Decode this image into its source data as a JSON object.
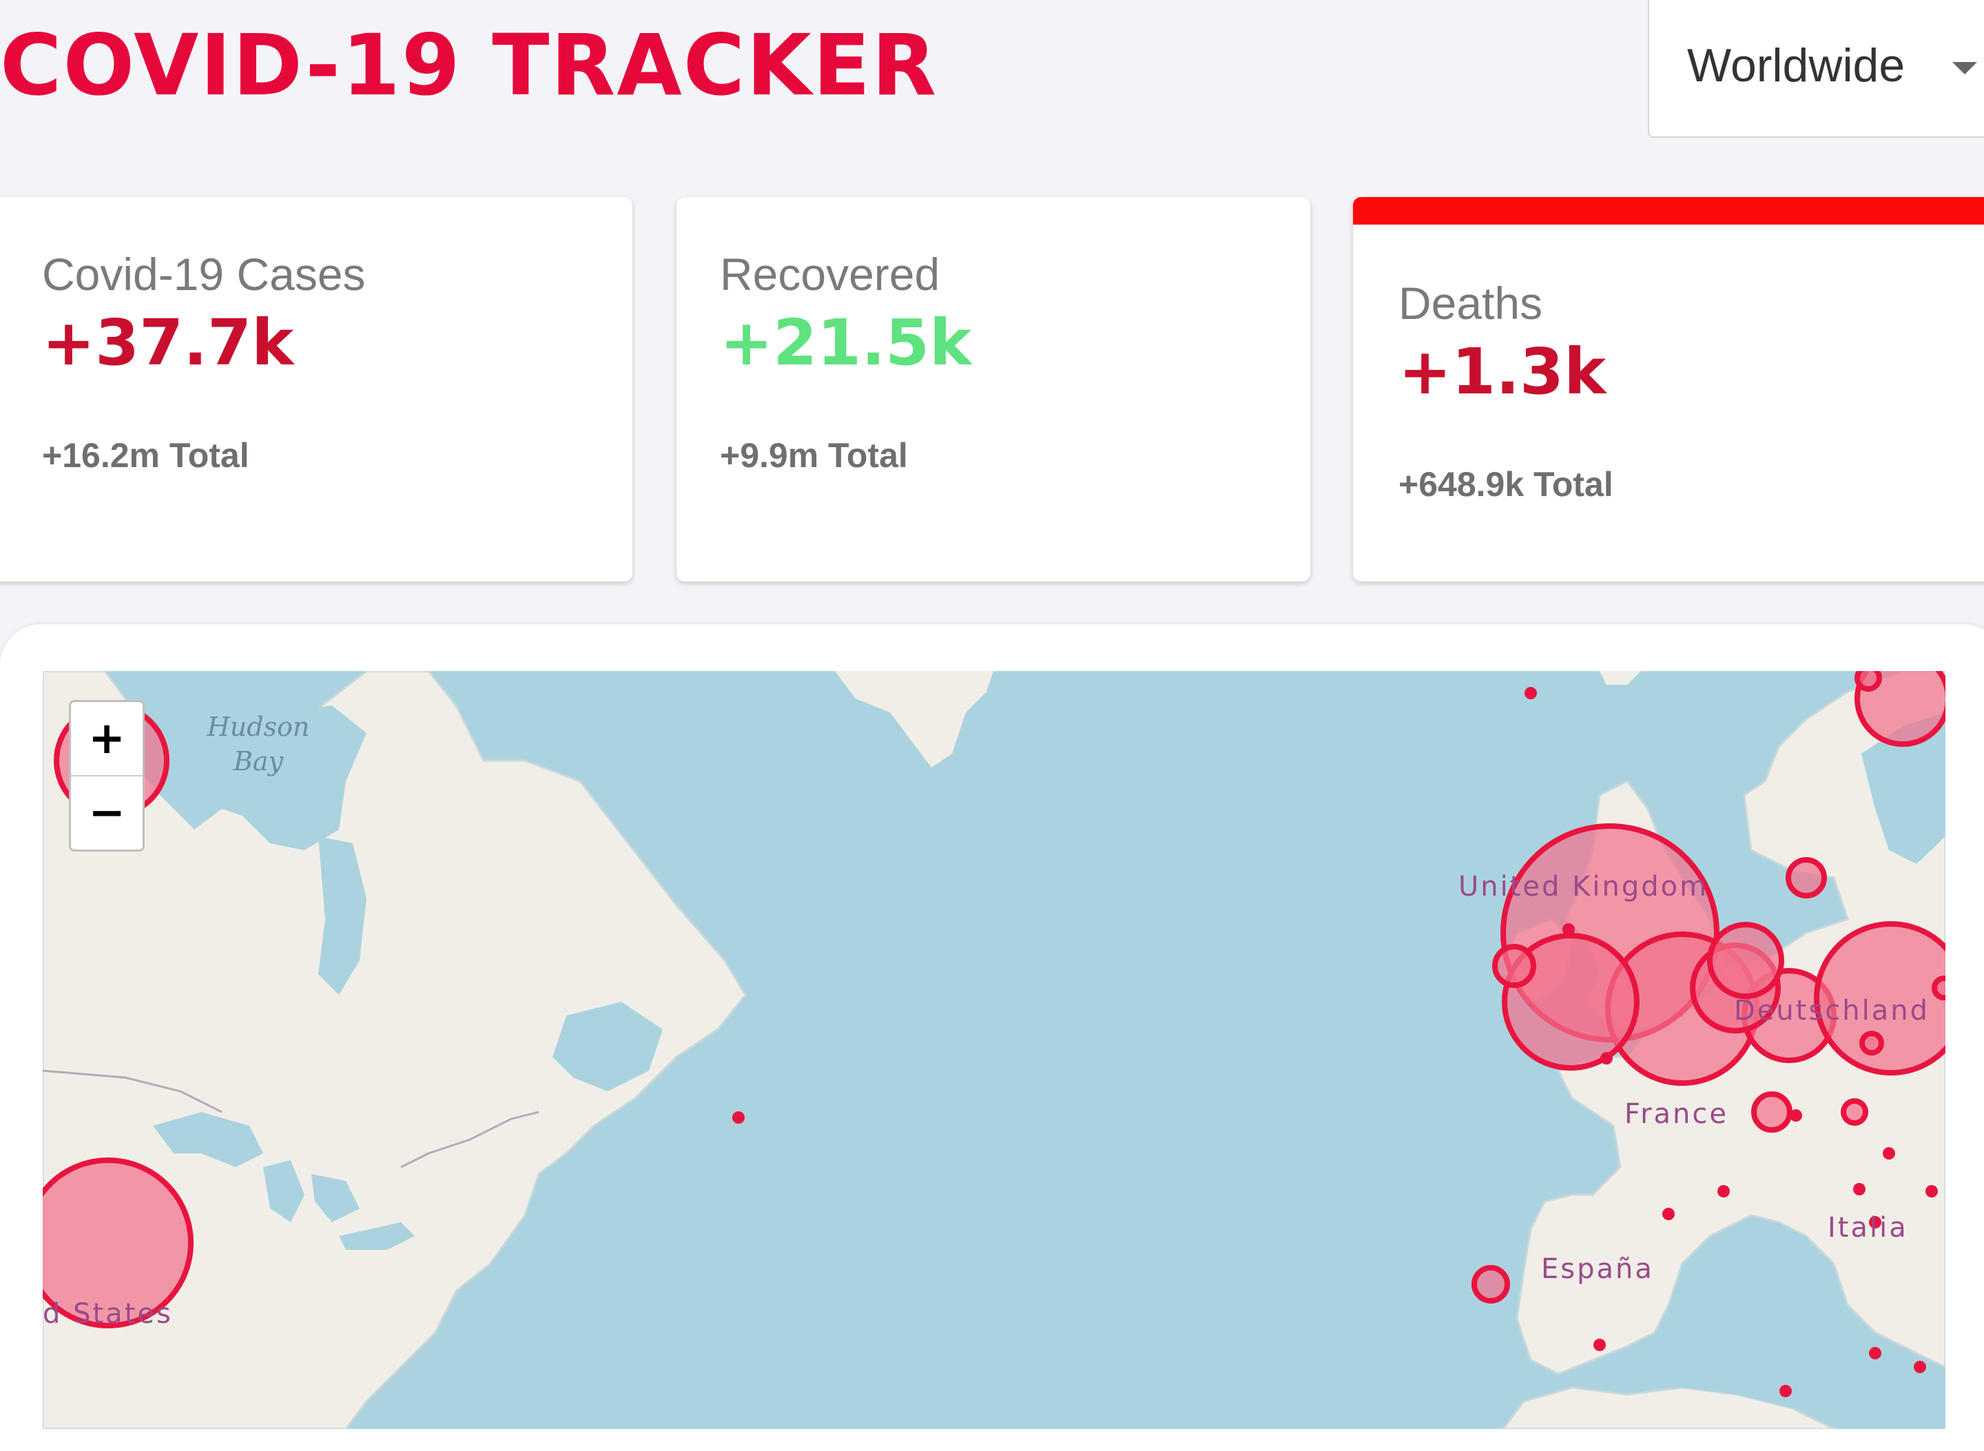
{
  "header": {
    "title": "COVID-19 TRACKER",
    "country_select": {
      "value": "Worldwide"
    }
  },
  "cards": {
    "cases": {
      "label": "Covid-19 Cases",
      "today": "+37.7k",
      "total": "+16.2m Total"
    },
    "recovered": {
      "label": "Recovered",
      "today": "+21.5k",
      "total": "+9.9m Total"
    },
    "deaths": {
      "label": "Deaths",
      "today": "+1.3k",
      "total": "+648.9k Total",
      "active": true
    }
  },
  "map": {
    "zoom_in": "+",
    "zoom_out": "−",
    "water_labels": {
      "hudson_bay": "Hudson\nBay"
    },
    "country_labels": {
      "united_states": "d States",
      "united_kingdom": "United Kingdom",
      "deutschland": "Deutschland",
      "france": "France",
      "espana": "España",
      "italia": "Italia"
    }
  },
  "colors": {
    "title": "#e6083a",
    "cases_today": "#c8102e",
    "recovered_today": "#5fe27f",
    "deaths_accent": "#ff0a0a",
    "circle_stroke": "#e8143f",
    "circle_fill": "#f2708c",
    "water": "#aad3df",
    "land": "#f1eee8"
  }
}
